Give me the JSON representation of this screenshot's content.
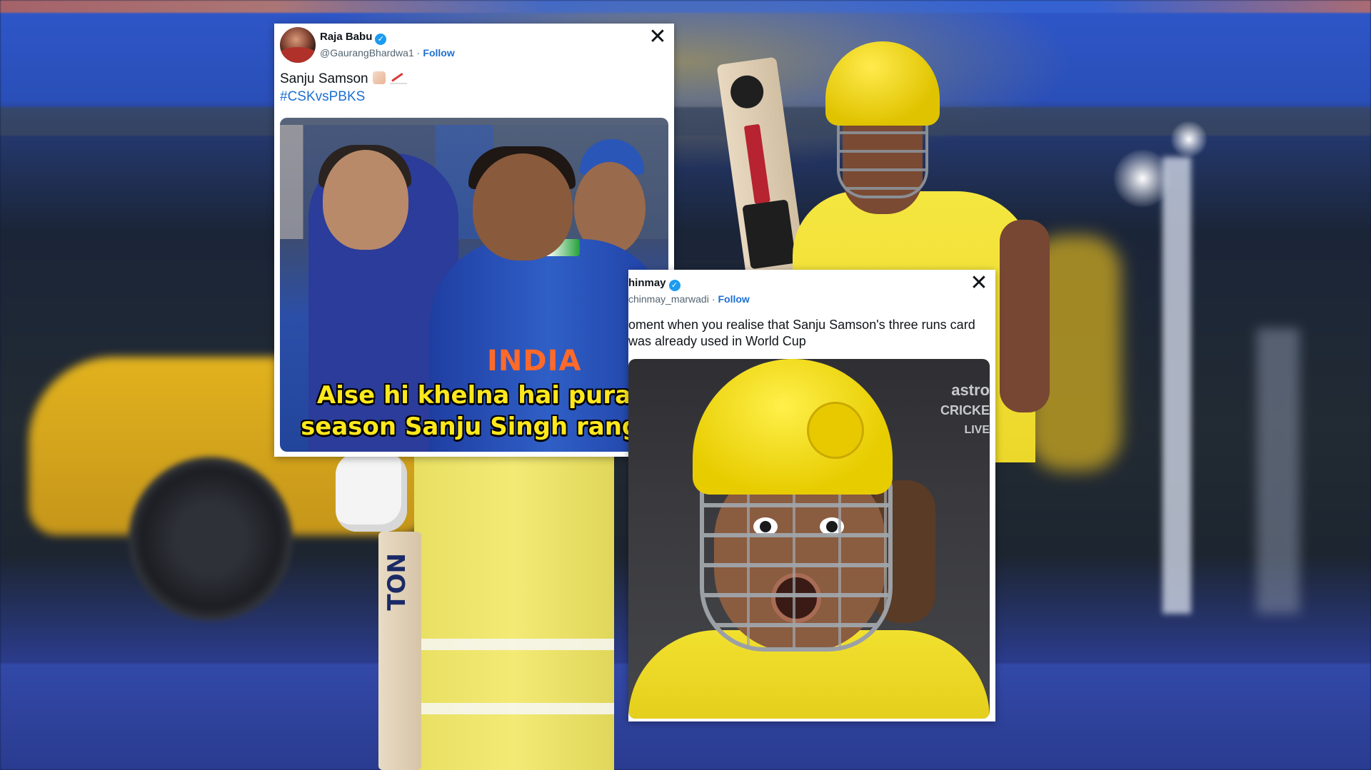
{
  "tweets": [
    {
      "user_name": "Raja Babu",
      "handle": "@GaurangBhardwa1",
      "follow_label": "Follow",
      "close_icon": "✕",
      "text": "Sanju Samson",
      "hashtag": "#CSKvsPBKS",
      "image": {
        "caption_line_1": "Aise hi khelna hai pura",
        "caption_line_2": "season Sanju Singh rangi",
        "jersey_text": "INDIA"
      }
    },
    {
      "user_name": "hinmay",
      "handle": "chinmay_marwadi",
      "follow_label": "Follow",
      "close_icon": "✕",
      "text": "oment when you realise that Sanju Samson's three runs card was already used in World Cup",
      "image": {
        "watermark_line_1": "astro",
        "watermark_line_2": "CRICKE",
        "watermark_line_3": "LIVE"
      }
    }
  ],
  "background": {
    "bat_text": "TON"
  },
  "colors": {
    "follow": "#1d6fd0",
    "verified": "#1d9bf0",
    "caption": "#ffe81c"
  }
}
